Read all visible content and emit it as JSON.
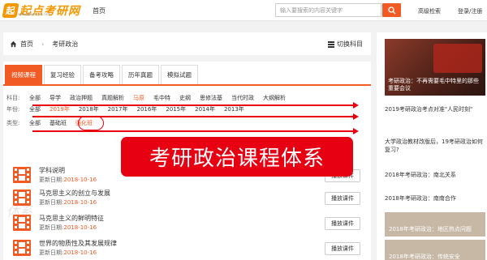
{
  "header": {
    "logo_text": "起点考研网",
    "logo_sub": "www.qdkaoyan.com",
    "nav_home": "首页",
    "search_placeholder": "输入要搜索的内容关键字",
    "advanced": "高级检索",
    "login": "登录/注册"
  },
  "breadcrumb": {
    "home": "首页",
    "current": "考研政治",
    "switch": "切换科目"
  },
  "tabs": [
    "视频课程",
    "复习经验",
    "备考攻略",
    "历年真题",
    "模拟试题"
  ],
  "filters": {
    "subject": {
      "label": "科目:",
      "options": [
        "全部",
        "导学",
        "政治押题",
        "真题解析",
        "马原",
        "毛中特",
        "史纲",
        "思修法基",
        "当代时政",
        "大纲解析"
      ]
    },
    "year": {
      "label": "年份:",
      "options": [
        "全部",
        "2019年",
        "2018年",
        "2017年",
        "2016年",
        "2015年",
        "2014年",
        "2013年"
      ]
    },
    "type": {
      "label": "类型:",
      "options": [
        "全部",
        "基础班",
        "强化班"
      ]
    }
  },
  "overlay_text": "考研政治课程体系",
  "watermark": "体系",
  "courses": [
    {
      "title": "学科说明",
      "date_label": "更新日期:",
      "date": "2018-10-16",
      "button": "播放课件"
    },
    {
      "title": "马克思主义的创立与发展",
      "date_label": "更新日期:",
      "date": "2018-10-16",
      "button": "播放课件"
    },
    {
      "title": "马克思主义的鲜明特征",
      "date_label": "更新日期:",
      "date": "2018-10-16",
      "button": "播放课件"
    },
    {
      "title": "世界的物质性及其发展规律",
      "date_label": "更新日期:",
      "date": "2018-10-16",
      "button": "播放课件"
    }
  ],
  "sidebar": {
    "banner_caption": "考研政治：不再需要毛中特里的那些重要会议",
    "items": [
      "2019考研政治考点对准\"人民时刻\"",
      "大学政治教材改版后，19考研政治如何复习?",
      "2018年考研政治：南北关系",
      "2018年考研政治：南南合作"
    ],
    "thumbs": [
      "2018年考研政治：地区热点问题",
      "2018年考研政治：传统安全"
    ]
  },
  "colors": {
    "accent": "#f15a22",
    "annotation_red": "#e60012",
    "brand": "#f39800"
  }
}
